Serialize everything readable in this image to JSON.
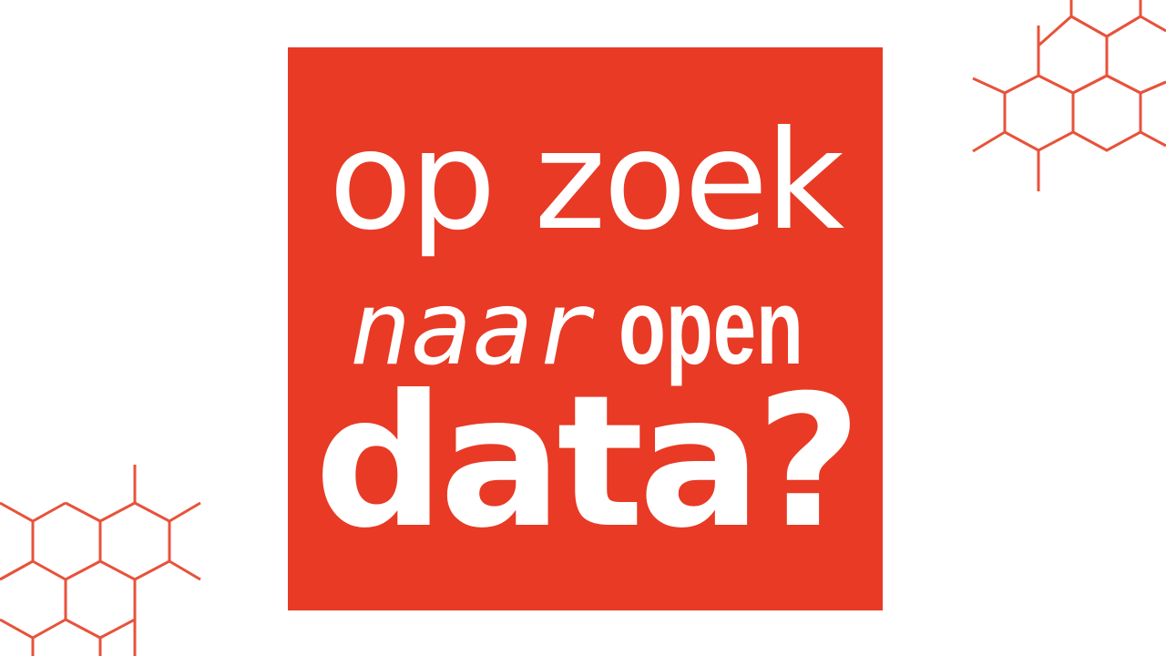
{
  "colors": {
    "background": "#ffffff",
    "box": "#e83a25",
    "text": "#ffffff",
    "hexagon_stroke": "#e8523a"
  },
  "headline": {
    "line1": "op zoek",
    "line2_word1": "naar",
    "line2_word2": "open",
    "line3": "data?"
  },
  "decorations": {
    "top_right": "hexagon-pattern",
    "bottom_left": "hexagon-pattern"
  }
}
